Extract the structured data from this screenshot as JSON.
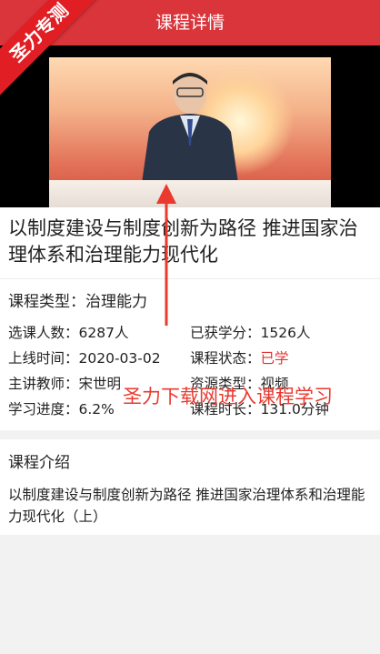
{
  "header": {
    "title": "课程详情"
  },
  "corner_badge": {
    "text": "圣力专测"
  },
  "course": {
    "title": "以制度建设与制度创新为路径 推进国家治理体系和治理能力现代化",
    "type_label": "课程类型：",
    "type_value": "治理能力",
    "fields": {
      "enroll_label": "选课人数：",
      "enroll_value": "6287人",
      "credits_label": "已获学分：",
      "credits_value": "1526人",
      "online_label": "上线时间：",
      "online_value": "2020-03-02",
      "status_label": "课程状态：",
      "status_value": "已学",
      "teacher_label": "主讲教师：",
      "teacher_value": "宋世明",
      "resource_label": "资源类型：",
      "resource_value": "视频",
      "progress_label": "学习进度：",
      "progress_value": "6.2%",
      "duration_label": "课程时长：",
      "duration_value": "131.0分钟"
    }
  },
  "intro": {
    "title": "课程介绍",
    "text": "以制度建设与制度创新为路径 推进国家治理体系和治理能力现代化（上）"
  },
  "watermark": {
    "text": "圣力下载网进入课程学习"
  },
  "colors": {
    "header": "#d9353b",
    "accent_red": "#e0312f",
    "badge": "#e11e24"
  }
}
